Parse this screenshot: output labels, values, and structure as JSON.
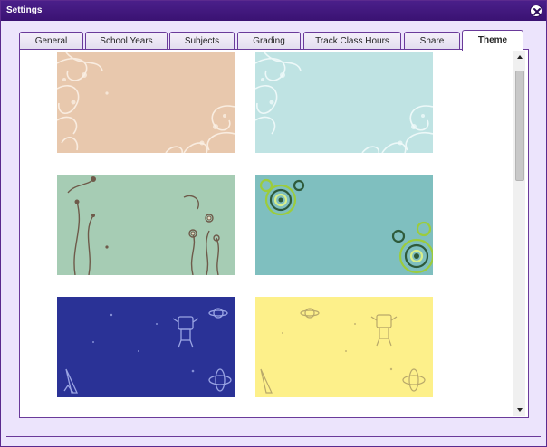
{
  "window": {
    "title": "Settings",
    "close_icon": "close-circle-icon"
  },
  "tabs": [
    {
      "label": "General",
      "active": false
    },
    {
      "label": "School Years",
      "active": false
    },
    {
      "label": "Subjects",
      "active": false
    },
    {
      "label": "Grading",
      "active": false
    },
    {
      "label": "Track Class Hours",
      "active": false
    },
    {
      "label": "Share",
      "active": false
    },
    {
      "label": "Theme",
      "active": true
    }
  ],
  "themes": [
    {
      "id": "peach-floral",
      "background": "#e8c8ad",
      "pattern": "white-floral-swirl-icon"
    },
    {
      "id": "aqua-floral",
      "background": "#bfe3e3",
      "pattern": "white-floral-swirl-icon"
    },
    {
      "id": "green-flowers",
      "background": "#a6ccb4",
      "pattern": "brown-flower-stems-icon"
    },
    {
      "id": "teal-circles",
      "background": "#7fbfbf",
      "pattern": "green-concentric-circles-icon"
    },
    {
      "id": "blue-robots",
      "background": "#2a3296",
      "pattern": "robot-rocket-planet-icon"
    },
    {
      "id": "yellow-robots",
      "background": "#fdf08a",
      "pattern": "robot-rocket-planet-icon"
    }
  ],
  "scrollbar": {
    "up_icon": "scroll-up-arrow-icon",
    "down_icon": "scroll-down-arrow-icon"
  }
}
